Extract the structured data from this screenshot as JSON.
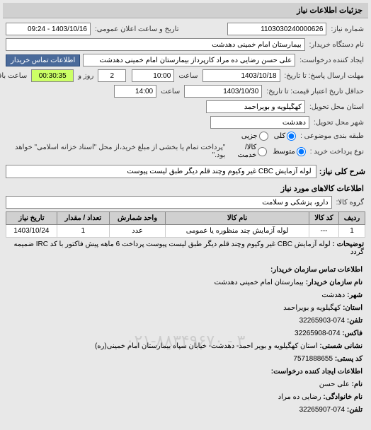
{
  "section_title": "جزئیات اطلاعات نیاز",
  "labels": {
    "req_number": "شماره نیاز:",
    "announce_datetime": "تاریخ و ساعت اعلان عمومی:",
    "buyer_org": "نام دستگاه خریدار:",
    "creator": "ایجاد کننده درخواست:",
    "contact_btn": "اطلاعات تماس خریدار",
    "deadline": "مهلت ارسال پاسخ: تا تاریخ:",
    "time": "ساعت",
    "days": "روز و",
    "remaining": "ساعت باقی مانده",
    "validity": "حداقل تاریخ اعتبار قیمت: تا تاریخ:",
    "province": "استان محل تحویل:",
    "city": "شهر محل تحویل:",
    "subject_cat": "طبقه بندی موضوعی :",
    "all": "کلی",
    "partial": "جزیی",
    "payment_type": "نوع پرداخت خرید :",
    "mid": "متوسط",
    "credit": "کالا/خدمت",
    "payment_note": "\"پرداخت تمام یا بخشی از مبلغ خرید،از محل \"اسناد خزانه اسلامی\" خواهد بود.\"",
    "main_desc": "شرح کلی نیاز:",
    "items_section": "اطلاعات کالاهای مورد نیاز",
    "product_group": "گروه کالا:",
    "explain_label": "توضیحات :",
    "contact_section": "اطلاعات تماس سازمان خریدار:",
    "org_name": "نام سازمان خریدار:",
    "city2": "شهر:",
    "province2": "استان:",
    "phone": "تلفن:",
    "fax": "فاکس:",
    "address": "نشانی شستی:",
    "postal": "کد پستی:",
    "creator_section": "اطلاعات ایجاد کننده درخواست:",
    "name": "نام:",
    "family": "نام خانوادگی:",
    "phone2": "تلفن:"
  },
  "values": {
    "req_number": "1103030240000626",
    "announce_datetime": "1403/10/16 - 09:24",
    "buyer_org": "بیمارستان امام خمینی دهدشت",
    "creator": "علی حسن رضایی ده مراد کارپرداز بیمارستان امام خمینی دهدشت",
    "deadline_date": "1403/10/18",
    "deadline_time": "10:00",
    "days_remaining": "2",
    "time_remaining": "00:30:35",
    "validity_date": "1403/10/30",
    "validity_time": "14:00",
    "province": "کهگیلویه و بویراحمد",
    "city": "دهدشت",
    "main_desc": "لوله آزمایش CBC غیر وکیوم وچند قلم دیگر طبق لیست پیوست",
    "product_group": "دارو، پزشکی و سلامت",
    "explain": "لوله آزمایش CBC غیر وکیوم وچند قلم دیگر طبق لیست پیوست پرداخت 6 ماهه پیش فاکتور با کد IRC ضمیمه گردد",
    "org_name_v": "بیمارستان امام خمینی دهدشت",
    "city_v": "دهدشت",
    "province_v": "کهگیلویه و بویراحمد",
    "phone_v": "074-32265903",
    "fax_v": "074-32265908",
    "address_v": "استان کهگیلویه و بویر احمد- دهدشت- خیابان سپاه بیمارستان امام خمینی(ره)",
    "postal_v": "7571888655",
    "name_v": "علی حسن",
    "family_v": "رضایی ده مراد",
    "phone2_v": "074-32265907",
    "watermark": "۰۲۱-۸۸۳۴۹۶۷۰ - ۳"
  },
  "table": {
    "headers": {
      "row": "ردیف",
      "code": "کد کالا",
      "name": "نام کالا",
      "unit": "واحد شمارش",
      "qty": "تعداد / مقدار",
      "date": "تاریخ نیاز"
    },
    "rows": [
      {
        "row": "1",
        "code": "---",
        "name": "لوله آزمایش چند منظوره یا عمومی",
        "unit": "عدد",
        "qty": "1",
        "date": "1403/10/24"
      }
    ]
  }
}
